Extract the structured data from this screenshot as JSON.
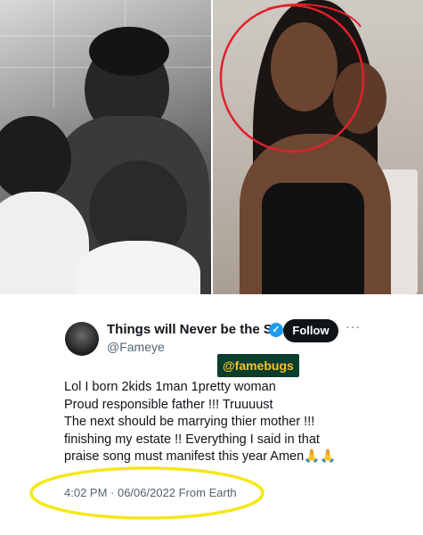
{
  "tweet": {
    "display_name": "Things will Never be the S...",
    "handle": "@Fameye",
    "follow_label": "Follow",
    "more_label": "···",
    "verified_glyph": "✓",
    "watermark": "@famebugs",
    "body_lines": [
      "Lol I born 2kids 1man 1pretty woman",
      "Proud responsible father !!! Truuuust",
      "The next should be marrying thier mother !!!",
      "finishing my estate !! Everything I said in that",
      "praise song must manifest this year Amen🙏🙏"
    ],
    "timestamp": "4:02 PM · 06/06/2022 From Earth"
  },
  "colors": {
    "follow_bg": "#0f1419",
    "verified": "#1d9bf0",
    "annotation_red": "#e0202a",
    "highlight_yellow": "#f4e81a",
    "watermark_bg": "#0a3d2b",
    "watermark_text": "#f2c230"
  }
}
